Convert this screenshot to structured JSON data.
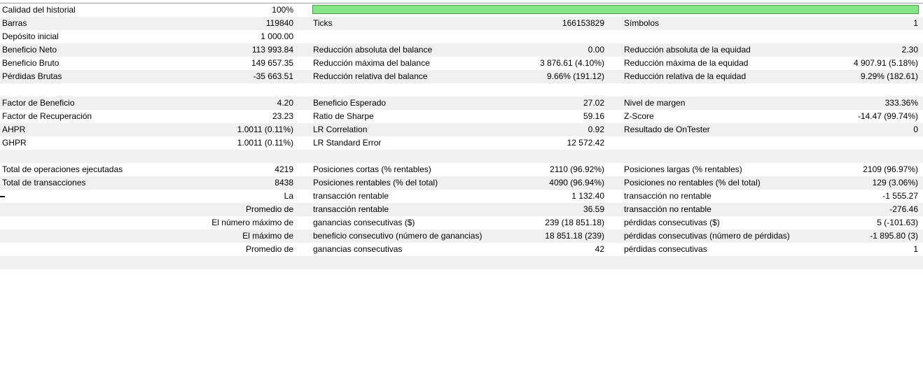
{
  "colors": {
    "row_alt": "#f0f0f0",
    "quality_fill": "#85e685",
    "quality_border": "#4c9a4c"
  },
  "quality": {
    "label": "Calidad del historial",
    "value": "100%",
    "fraction": 1.0
  },
  "r1": {
    "l1": "Barras",
    "v1": "119840",
    "l2": "Ticks",
    "v2": "166153829",
    "l3": "Símbolos",
    "v3": "1"
  },
  "r2": {
    "l1": "Depósito inicial",
    "v1": "1 000.00"
  },
  "r3": {
    "l1": "Beneficio Neto",
    "v1": "113 993.84",
    "l2": "Reducción absoluta del balance",
    "v2": "0.00",
    "l3": "Reducción absoluta de la equidad",
    "v3": "2.30"
  },
  "r4": {
    "l1": "Beneficio Bruto",
    "v1": "149 657.35",
    "l2": "Reducción máxima del balance",
    "v2": "3 876.61 (4.10%)",
    "l3": "Reducción máxima de la equidad",
    "v3": "4 907.91 (5.18%)"
  },
  "r5": {
    "l1": "Pérdidas Brutas",
    "v1": "-35 663.51",
    "l2": "Reducción relativa del balance",
    "v2": "9.66% (191.12)",
    "l3": "Reducción relativa de la equidad",
    "v3": "9.29% (182.61)"
  },
  "r7": {
    "l1": "Factor de Beneficio",
    "v1": "4.20",
    "l2": "Beneficio Esperado",
    "v2": "27.02",
    "l3": "Nivel de margen",
    "v3": "333.36%"
  },
  "r8": {
    "l1": "Factor de Recuperación",
    "v1": "23.23",
    "l2": "Ratio de Sharpe",
    "v2": "59.16",
    "l3": "Z-Score",
    "v3": "-14.47 (99.74%)"
  },
  "r9": {
    "l1": "AHPR",
    "v1": "1.0011 (0.11%)",
    "l2": "LR Correlation",
    "v2": "0.92",
    "l3": "Resultado de OnTester",
    "v3": "0"
  },
  "r10": {
    "l1": "GHPR",
    "v1": "1.0011 (0.11%)",
    "l2": "LR Standard Error",
    "v2": "12 572.42"
  },
  "r12": {
    "l1": "Total de operaciones ejecutadas",
    "v1": "4219",
    "l2": "Posiciones cortas (% rentables)",
    "v2": "2110 (96.92%)",
    "l3": "Posiciones largas (% rentables)",
    "v3": "2109 (96.97%)"
  },
  "r13": {
    "l1": "Total de transacciones",
    "v1": "8438",
    "l2": "Posiciones rentables (% del total)",
    "v2": "4090 (96.94%)",
    "l3": "Posiciones no rentables (% del total)",
    "v3": "129 (3.06%)"
  },
  "r14": {
    "prefix": "La",
    "l2": "transacción rentable",
    "v2": "1 132.40",
    "l3": "transacción no rentable",
    "v3": "-1 555.27"
  },
  "r15": {
    "prefix": "Promedio de",
    "l2": "transacción rentable",
    "v2": "36.59",
    "l3": "transacción no rentable",
    "v3": "-276.46"
  },
  "r16": {
    "prefix": "El número máximo de",
    "l2": "ganancias consecutivas ($)",
    "v2": "239 (18 851.18)",
    "l3": "pérdidas consecutivas ($)",
    "v3": "5 (-101.63)"
  },
  "r17": {
    "prefix": "El máximo de",
    "l2": "beneficio consecutivo (número de ganancias)",
    "v2": "18 851.18 (239)",
    "l3": "pérdidas consecutivas (número de pérdidas)",
    "v3": "-1 895.80 (3)"
  },
  "r18": {
    "prefix": "Promedio de",
    "l2": "ganancias consecutivas",
    "v2": "42",
    "l3": "pérdidas consecutivas",
    "v3": "1"
  }
}
